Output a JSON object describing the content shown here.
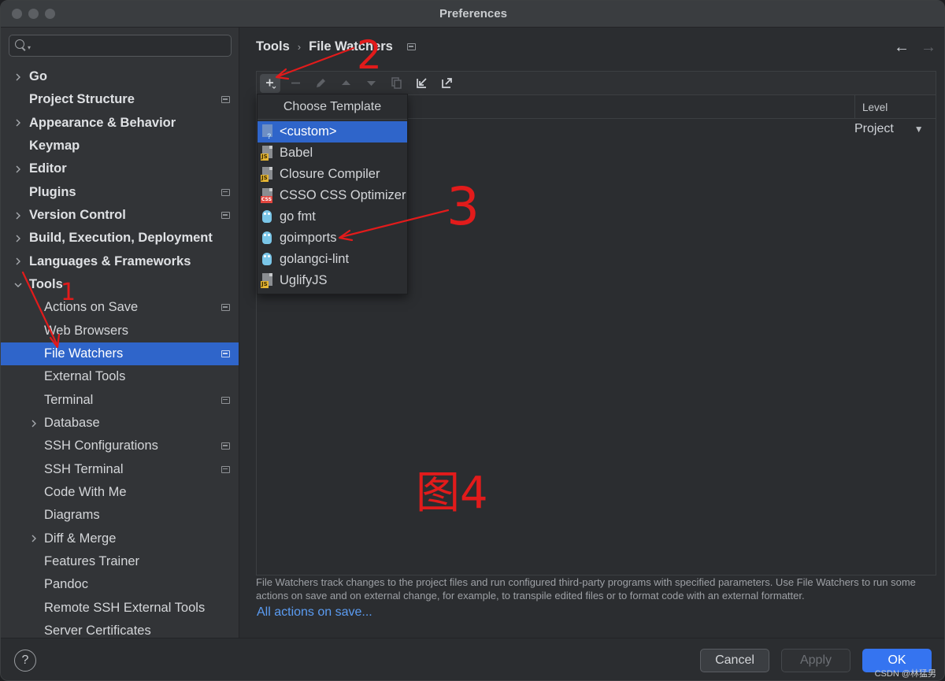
{
  "window": {
    "title": "Preferences"
  },
  "search": {
    "placeholder": "",
    "value": ""
  },
  "sidebar": {
    "items": [
      {
        "label": "Go",
        "level": 0,
        "expandable": true,
        "expanded": false,
        "project": false,
        "bold": true
      },
      {
        "label": "Project Structure",
        "level": 0,
        "expandable": false,
        "project": true,
        "bold": true
      },
      {
        "label": "Appearance & Behavior",
        "level": 0,
        "expandable": true,
        "expanded": false,
        "project": false,
        "bold": true
      },
      {
        "label": "Keymap",
        "level": 0,
        "expandable": false,
        "project": false,
        "bold": true
      },
      {
        "label": "Editor",
        "level": 0,
        "expandable": true,
        "expanded": false,
        "project": false,
        "bold": true
      },
      {
        "label": "Plugins",
        "level": 0,
        "expandable": false,
        "project": true,
        "bold": true
      },
      {
        "label": "Version Control",
        "level": 0,
        "expandable": true,
        "expanded": false,
        "project": true,
        "bold": true
      },
      {
        "label": "Build, Execution, Deployment",
        "level": 0,
        "expandable": true,
        "expanded": false,
        "project": false,
        "bold": true
      },
      {
        "label": "Languages & Frameworks",
        "level": 0,
        "expandable": true,
        "expanded": false,
        "project": false,
        "bold": true
      },
      {
        "label": "Tools",
        "level": 0,
        "expandable": true,
        "expanded": true,
        "project": false,
        "bold": true
      },
      {
        "label": "Actions on Save",
        "level": 1,
        "expandable": false,
        "project": true
      },
      {
        "label": "Web Browsers",
        "level": 1,
        "expandable": false,
        "project": false
      },
      {
        "label": "File Watchers",
        "level": 1,
        "expandable": false,
        "project": true,
        "selected": true
      },
      {
        "label": "External Tools",
        "level": 1,
        "expandable": false,
        "project": false
      },
      {
        "label": "Terminal",
        "level": 1,
        "expandable": false,
        "project": true
      },
      {
        "label": "Database",
        "level": 1,
        "expandable": true,
        "expanded": false,
        "project": false
      },
      {
        "label": "SSH Configurations",
        "level": 1,
        "expandable": false,
        "project": true
      },
      {
        "label": "SSH Terminal",
        "level": 1,
        "expandable": false,
        "project": true
      },
      {
        "label": "Code With Me",
        "level": 1,
        "expandable": false,
        "project": false
      },
      {
        "label": "Diagrams",
        "level": 1,
        "expandable": false,
        "project": false
      },
      {
        "label": "Diff & Merge",
        "level": 1,
        "expandable": true,
        "expanded": false,
        "project": false
      },
      {
        "label": "Features Trainer",
        "level": 1,
        "expandable": false,
        "project": false
      },
      {
        "label": "Pandoc",
        "level": 1,
        "expandable": false,
        "project": false
      },
      {
        "label": "Remote SSH External Tools",
        "level": 1,
        "expandable": false,
        "project": false
      },
      {
        "label": "Server Certificates",
        "level": 1,
        "expandable": false,
        "project": false
      }
    ]
  },
  "breadcrumb": {
    "parent": "Tools",
    "current": "File Watchers"
  },
  "table": {
    "level_header": "Level",
    "row_level_value": "Project"
  },
  "dropdown": {
    "title": "Choose Template",
    "items": [
      {
        "label": "<custom>",
        "icon": "custom-file-icon",
        "selected": true
      },
      {
        "label": "Babel",
        "icon": "js-file-icon"
      },
      {
        "label": "Closure Compiler",
        "icon": "js-file-icon"
      },
      {
        "label": "CSSO CSS Optimizer",
        "icon": "css-file-icon"
      },
      {
        "label": "go fmt",
        "icon": "gopher-icon"
      },
      {
        "label": "goimports",
        "icon": "gopher-icon"
      },
      {
        "label": "golangci-lint",
        "icon": "gopher-icon"
      },
      {
        "label": "UglifyJS",
        "icon": "js-file-icon"
      }
    ]
  },
  "description": "File Watchers track changes to the project files and run configured third-party programs with specified parameters. Use File Watchers to run some actions on save and on external change, for example, to transpile edited files or to format code with an external formatter.",
  "link": "All actions on save...",
  "footer": {
    "help": "?",
    "cancel": "Cancel",
    "apply": "Apply",
    "ok": "OK"
  },
  "annotations": {
    "n1": "1",
    "n2": "2",
    "n3": "3",
    "figure_label": "图4",
    "color": "#e21b1b"
  },
  "watermark": "CSDN @林猛男",
  "colors": {
    "accent": "#2f65ca",
    "ok_button": "#3574f0",
    "link": "#5b9cf2"
  }
}
